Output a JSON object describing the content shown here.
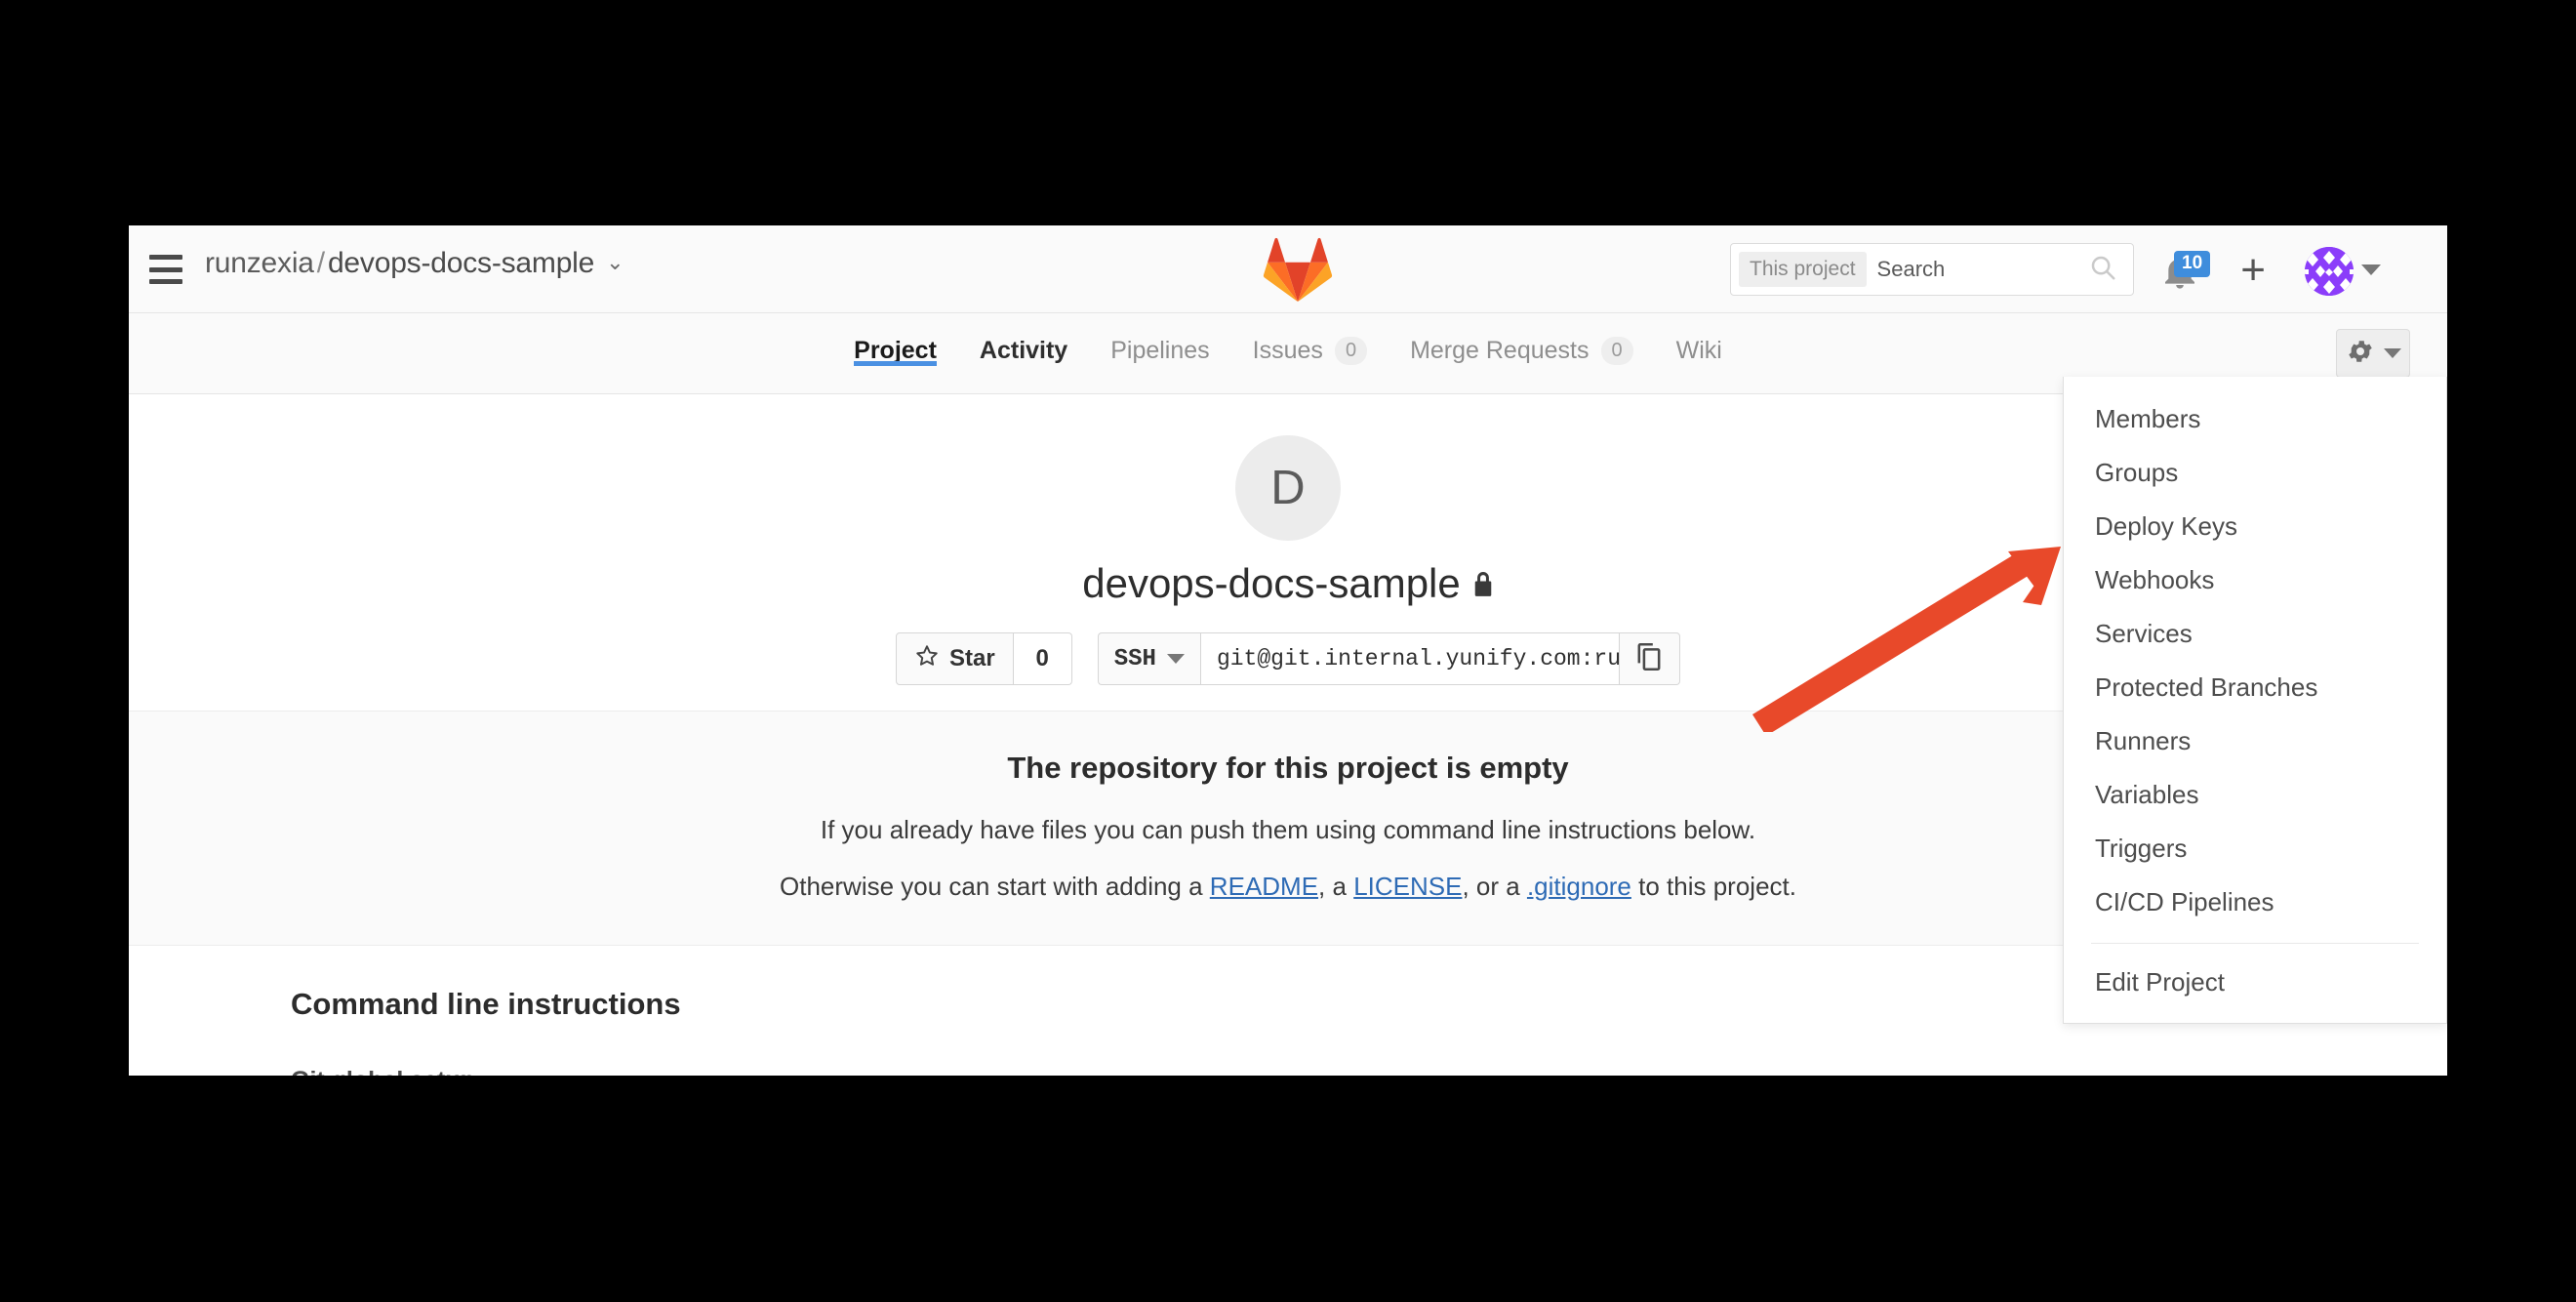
{
  "header": {
    "menu_icon": "hamburger-icon",
    "breadcrumb": {
      "group": "runzexia",
      "separator": "/",
      "project": "devops-docs-sample",
      "caret": "⌄"
    },
    "logo": "gitlab-tanuki-logo",
    "search": {
      "scope": "This project",
      "placeholder": "Search",
      "value": "",
      "icon": "search-icon"
    },
    "notifications": {
      "icon": "bell-icon",
      "count": "10"
    },
    "new_icon": "plus-icon",
    "avatar": "user-identicon-avatar",
    "user_caret": "chevron-down-icon"
  },
  "nav": {
    "tabs": [
      {
        "label": "Project",
        "count": null,
        "active": true,
        "strong": true
      },
      {
        "label": "Activity",
        "count": null,
        "active": false,
        "strong": true
      },
      {
        "label": "Pipelines",
        "count": null,
        "active": false,
        "strong": false
      },
      {
        "label": "Issues",
        "count": "0",
        "active": false,
        "strong": false
      },
      {
        "label": "Merge Requests",
        "count": "0",
        "active": false,
        "strong": false
      },
      {
        "label": "Wiki",
        "count": null,
        "active": false,
        "strong": false
      }
    ],
    "settings_button": {
      "icon": "gear-icon",
      "caret": "chevron-down-icon"
    }
  },
  "project": {
    "avatar_letter": "D",
    "name": "devops-docs-sample",
    "visibility_icon": "lock-icon",
    "star": {
      "label": "Star",
      "icon": "star-outline-icon",
      "count": "0"
    },
    "clone": {
      "protocol": "SSH",
      "protocol_caret": "▾",
      "url": "git@git.internal.yunify.com:ru",
      "copy_icon": "copy-icon"
    }
  },
  "empty_repo": {
    "title": "The repository for this project is empty",
    "line1": "If you already have files you can push them using command line instructions below.",
    "line2_pre": "Otherwise you can start with adding a ",
    "link_readme": "README",
    "line2_mid1": ", a ",
    "link_license": "LICENSE",
    "line2_mid2": ", or a ",
    "link_gitignore": ".gitignore",
    "line2_post": " to this project."
  },
  "cli": {
    "heading": "Command line instructions",
    "subheading": "Git global setup"
  },
  "settings_menu": {
    "items": [
      "Members",
      "Groups",
      "Deploy Keys",
      "Webhooks",
      "Services",
      "Protected Branches",
      "Runners",
      "Variables",
      "Triggers",
      "CI/CD Pipelines"
    ],
    "footer_item": "Edit Project"
  },
  "annotation": {
    "arrow": "orange-arrow-pointing-to-webhooks",
    "color": "#e8492a"
  },
  "colors": {
    "accent_blue": "#4a90e2",
    "link_blue": "#2e6bb5",
    "badge_blue": "#3f8ddc",
    "header_bg": "#fafafa",
    "arrow_orange": "#e8492a"
  }
}
